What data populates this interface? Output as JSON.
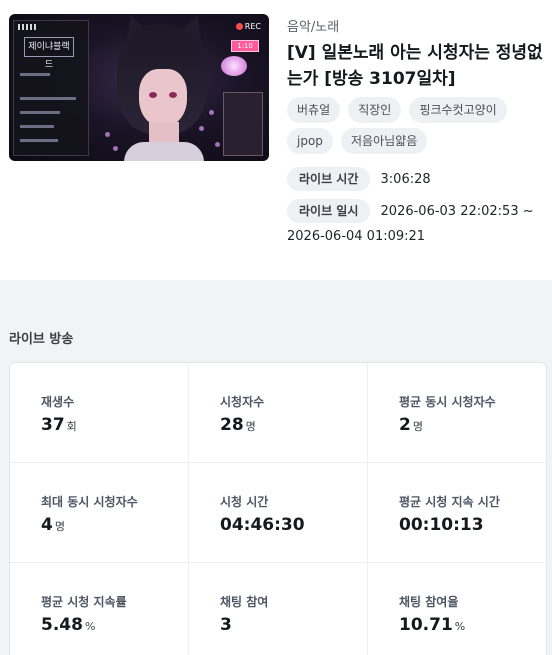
{
  "video": {
    "category": "음악/노래",
    "title": "[V] 일본노래 아는 시청자는 정녕없는가 [방송 3107일차]",
    "tags": [
      "버츄얼",
      "직장인",
      "핑크수컷고양이",
      "jpop",
      "저음아님얇음"
    ],
    "live_time_label": "라이브 시간",
    "live_time_value": "3:06:28",
    "live_date_label": "라이브 일시",
    "live_date_value": "2026-06-03 22:02:53 ~",
    "live_date_end": "2026-06-04 01:09:21"
  },
  "thumbnail": {
    "rec_label": "REC",
    "panel_title": "제이냐블랙드",
    "time_badge": "1:10"
  },
  "section": {
    "title": "라이브 방송"
  },
  "stats": [
    {
      "label": "재생수",
      "value": "37",
      "unit": "회"
    },
    {
      "label": "시청자수",
      "value": "28",
      "unit": "명"
    },
    {
      "label": "평균 동시 시청자수",
      "value": "2",
      "unit": "명"
    },
    {
      "label": "최대 동시 시청자수",
      "value": "4",
      "unit": "명"
    },
    {
      "label": "시청 시간",
      "value": "04:46:30",
      "unit": ""
    },
    {
      "label": "평균 시청 지속 시간",
      "value": "00:10:13",
      "unit": ""
    },
    {
      "label": "평균 시청 지속률",
      "value": "5.48",
      "unit": "%"
    },
    {
      "label": "채팅 참여",
      "value": "3",
      "unit": ""
    },
    {
      "label": "채팅 참여율",
      "value": "10.71",
      "unit": "%"
    }
  ]
}
